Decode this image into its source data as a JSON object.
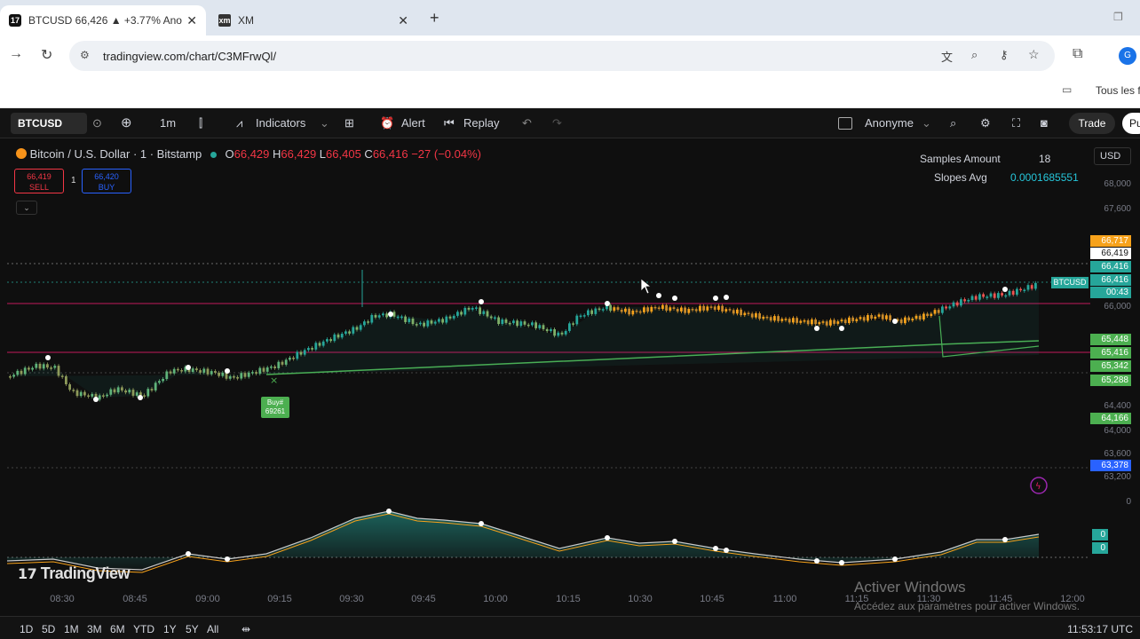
{
  "browser": {
    "tabs": [
      {
        "title": "BTCUSD 66,426 ▲ +3.77% Ano",
        "icon": "tradingview-icon"
      },
      {
        "title": "XM",
        "icon": "xm-icon"
      }
    ],
    "url": "tradingview.com/chart/C3MFrwQl/",
    "bookmark": "Tous les f"
  },
  "toolbar": {
    "symbol": "BTCUSD",
    "interval": "1m",
    "indicators": "Indicators",
    "alert": "Alert",
    "replay": "Replay",
    "account": "Anonyme",
    "trade": "Trade",
    "publish": "Pu"
  },
  "legend": {
    "title": "Bitcoin / U.S. Dollar · 1 · Bitstamp",
    "o": "66,429",
    "h": "66,429",
    "l": "66,405",
    "c": "66,416",
    "change": "−27 (−0.04%)",
    "sell_price": "66,419",
    "sell_label": "SELL",
    "buy_price": "66,420",
    "buy_label": "BUY",
    "spread": "1"
  },
  "stats": {
    "samples_label": "Samples Amount",
    "samples_value": "18",
    "slopes_label": "Slopes Avg",
    "slopes_value": "0.0001685551"
  },
  "price_axis": {
    "currency": "USD",
    "labels": [
      "68,000",
      "67,600",
      "66,000",
      "64,400",
      "64,000",
      "63,600",
      "63,200",
      "0"
    ],
    "badges": [
      {
        "text": "66,717",
        "color": "#f7a21b"
      },
      {
        "text": "66,419",
        "color": "#ffffff"
      },
      {
        "text": "66,416",
        "color": "#26a69a"
      },
      {
        "text": "66,416",
        "color": "#26a69a"
      },
      {
        "text": "00:43",
        "color": "#26a69a"
      },
      {
        "text": "65,448",
        "color": "#4caf50"
      },
      {
        "text": "65,416",
        "color": "#4caf50"
      },
      {
        "text": "65,342",
        "color": "#4caf50"
      },
      {
        "text": "65,288",
        "color": "#4caf50"
      },
      {
        "text": "64,166",
        "color": "#4caf50"
      },
      {
        "text": "63,378",
        "color": "#2962ff"
      },
      {
        "text": "0",
        "color": "#26a69a"
      },
      {
        "text": "0",
        "color": "#26a69a"
      }
    ],
    "btc_label": "BTCUSD"
  },
  "time_axis": [
    "08:30",
    "08:45",
    "09:00",
    "09:15",
    "09:30",
    "09:45",
    "10:00",
    "10:15",
    "10:30",
    "10:45",
    "11:00",
    "11:15",
    "11:30",
    "11:45",
    "12:00"
  ],
  "bottom_bar": {
    "ranges": [
      "1D",
      "5D",
      "1M",
      "3M",
      "6M",
      "YTD",
      "1Y",
      "5Y",
      "All"
    ],
    "clock": "11:53:17 UTC"
  },
  "buy_marker": {
    "line1": "Buy#",
    "line2": "69261"
  },
  "logo": "TradingView",
  "watermark": {
    "title": "Activer Windows",
    "subtitle": "Accédez aux paramètres pour activer Windows."
  },
  "colors": {
    "up": "#26a69a",
    "down": "#ef5350",
    "accent_orange": "#f7a21b",
    "accent_green": "#4caf50",
    "background": "#0f0f0f"
  }
}
